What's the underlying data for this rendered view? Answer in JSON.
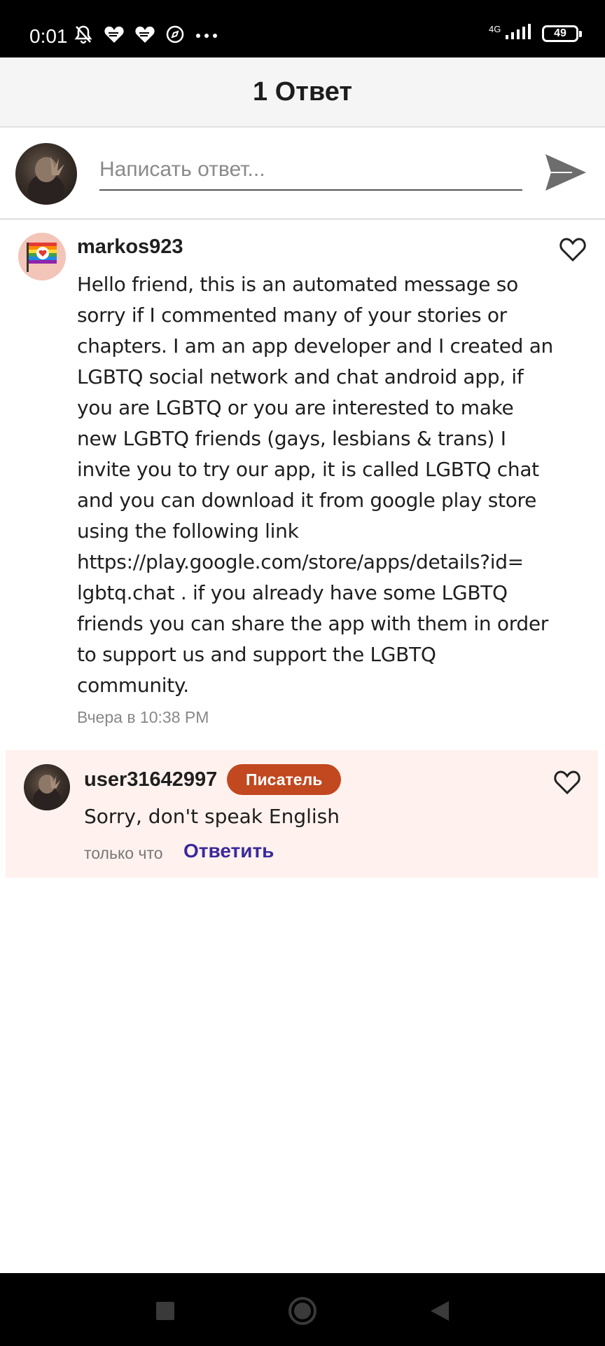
{
  "status_bar": {
    "time": "0:01",
    "network": "4G",
    "battery": "49",
    "icons": [
      "notifications-off-icon",
      "heart-app-icon",
      "heart-app-icon",
      "compass-icon",
      "more-dots-icon",
      "signal-icon",
      "battery-icon"
    ]
  },
  "header": {
    "title": "1 Ответ"
  },
  "reply_box": {
    "placeholder": "Написать ответ...",
    "send_icon": "send-icon"
  },
  "comments": [
    {
      "username": "markos923",
      "avatar_icon": "rainbow-flag-avatar",
      "body_lines": [
        "Hello friend, this is an automated message so",
        "sorry if I commented many of your stories or",
        "chapters. I am an app developer and I created an",
        "LGBTQ social network and chat android app, if",
        "you are LGBTQ or you are interested to make",
        "new LGBTQ friends (gays, lesbians & trans) I",
        "invite you to try our app, it is called LGBTQ chat",
        "and you can download it from google play store",
        "using the following link",
        "https://play.google.com/store/apps/details?id=",
        "lgbtq.chat . if you already have some LGBTQ",
        "friends you can share the app with them in order",
        "to support us and support the LGBTQ",
        "community."
      ],
      "timestamp": "Вчера в 10:38 PM",
      "like_icon": "heart-outline-icon"
    },
    {
      "username": "user31642997",
      "badge": "Писатель",
      "body": "Sorry, don't speak English",
      "timestamp": "только что",
      "reply_label": "Ответить",
      "like_icon": "heart-outline-icon"
    }
  ],
  "nav_bar": {
    "icons": [
      "recents-square-icon",
      "home-circle-icon",
      "back-triangle-icon"
    ]
  },
  "colors": {
    "badge": "#c1481f",
    "reply_link": "#3b2a9b",
    "reply_bg": "#fff2ee",
    "header_bg": "#f5f5f5"
  }
}
